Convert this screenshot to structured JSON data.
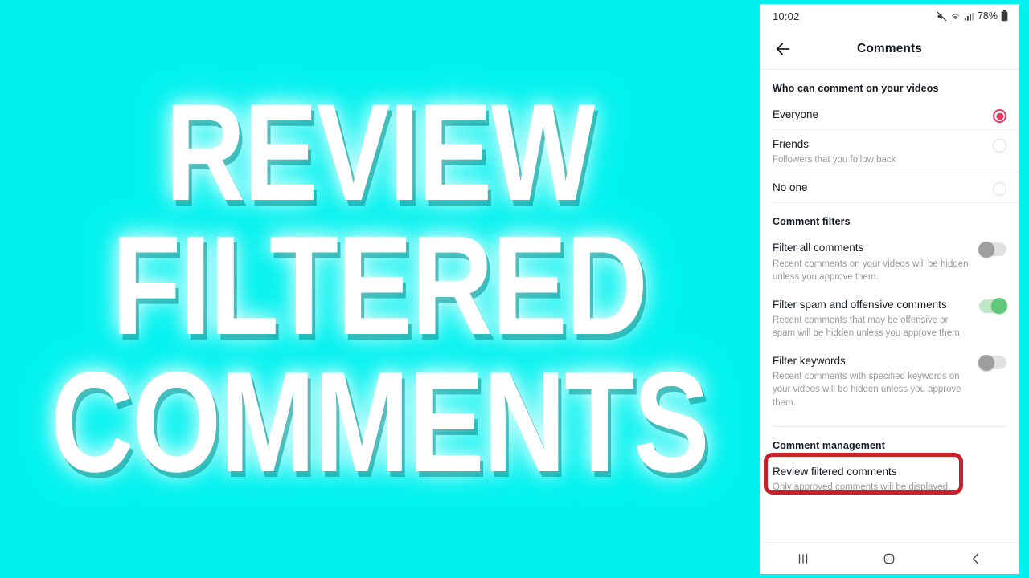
{
  "thumbnail": {
    "lines": [
      "REVIEW",
      "FILTERED",
      "COMMENTS"
    ],
    "background_color": "#00F2F0",
    "text_color": "#FFFFFF"
  },
  "phone": {
    "status_bar": {
      "time": "10:02",
      "battery_percent": "78%",
      "icons": [
        "mute-icon",
        "wifi-icon",
        "cellular-signal-icon",
        "battery-icon"
      ]
    },
    "app_bar": {
      "back_label": "back-arrow",
      "title": "Comments"
    },
    "sections": [
      {
        "heading": "Who can comment on your videos",
        "rows": [
          {
            "title": "Everyone",
            "subtitle": "",
            "control": "radio",
            "selected": true
          },
          {
            "title": "Friends",
            "subtitle": "Followers that you follow back",
            "control": "radio",
            "selected": false
          },
          {
            "title": "No one",
            "subtitle": "",
            "control": "radio",
            "selected": false
          }
        ]
      },
      {
        "heading": "Comment filters",
        "rows": [
          {
            "title": "Filter all comments",
            "subtitle": "Recent comments on your videos will be hidden unless you approve them.",
            "control": "toggle",
            "on": false
          },
          {
            "title": "Filter spam and offensive comments",
            "subtitle": "Recent comments that may be offensive or spam will be hidden unless you approve them",
            "control": "toggle",
            "on": true
          },
          {
            "title": "Filter keywords",
            "subtitle": "Recent comments with specified keywords on your videos will be hidden unless you approve them.",
            "control": "toggle",
            "on": false
          }
        ]
      },
      {
        "heading": "Comment management",
        "rows": [
          {
            "title": "Review filtered comments",
            "subtitle": "Only approved comments will be displayed.",
            "control": "none",
            "highlighted": true
          }
        ]
      }
    ],
    "nav_bar": {
      "recents_label": "recents-icon",
      "home_label": "home-icon",
      "back_label": "back-icon"
    },
    "colors": {
      "accent_radio": "#EA3A60",
      "toggle_on": "#5EC97A",
      "toggle_off": "#9E9E9E",
      "highlight_outline": "#CC2028"
    }
  }
}
